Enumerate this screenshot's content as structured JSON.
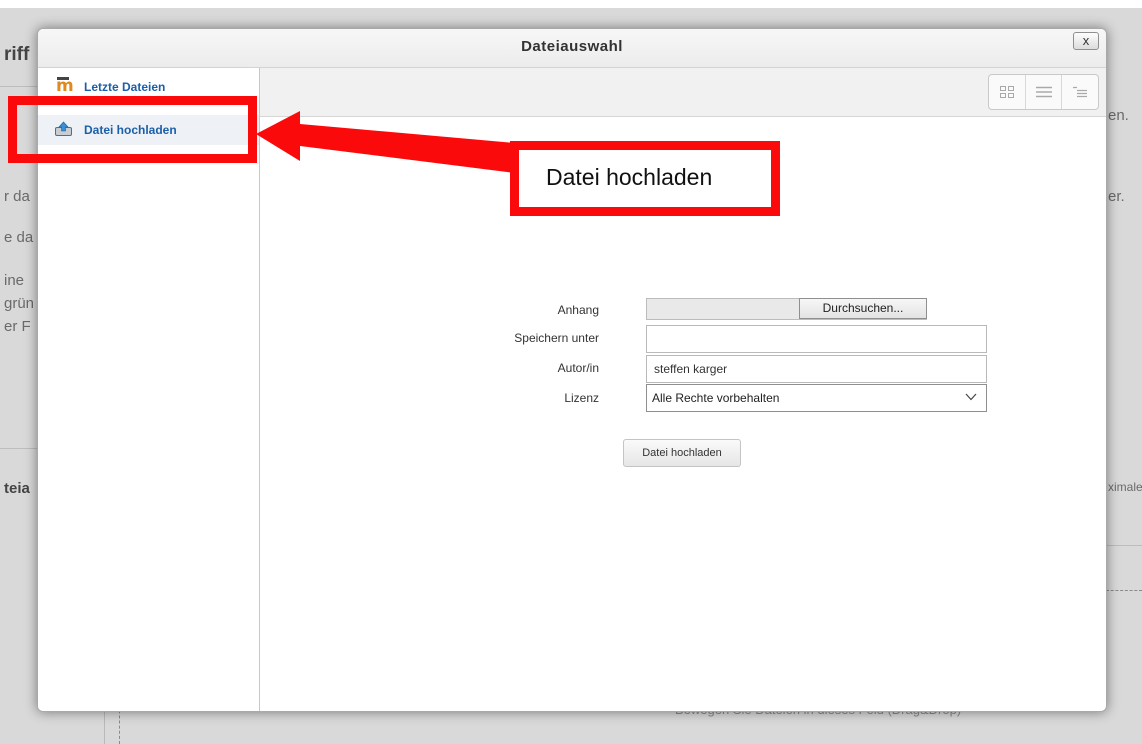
{
  "background": {
    "fragments": [
      "riff",
      "en.",
      "r da",
      "er.",
      "e da",
      "ine",
      "grün",
      "er F",
      "teia",
      "ximale"
    ],
    "bottom_hint": "Bewegen Sie Dateien in dieses Feld (Drag&Drop)"
  },
  "dialog": {
    "title": "Dateiauswahl",
    "close_label": "x",
    "sidebar": {
      "items": [
        {
          "label": "Letzte Dateien",
          "icon": "moodle-icon"
        },
        {
          "label": "Datei hochladen",
          "icon": "upload-icon"
        }
      ]
    },
    "view_buttons": [
      "icons-view-icon",
      "list-view-icon",
      "tree-view-icon"
    ],
    "form": {
      "attachment_label": "Anhang",
      "browse_label": "Durchsuchen...",
      "save_as_label": "Speichern unter",
      "save_as_value": "",
      "author_label": "Autor/in",
      "author_value": "steffen karger",
      "license_label": "Lizenz",
      "license_value": "Alle Rechte vorbehalten",
      "submit_label": "Datei hochladen"
    }
  },
  "annotation": {
    "callout_text": "Datei hochladen",
    "color": "#fa0a0a"
  }
}
